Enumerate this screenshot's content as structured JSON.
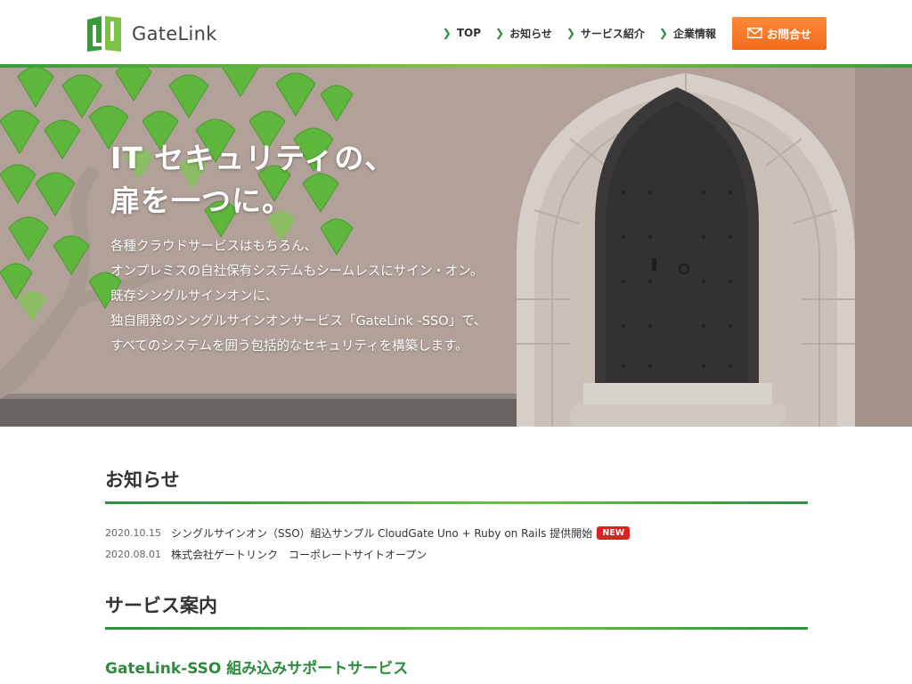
{
  "header": {
    "logo_text": "GateLink",
    "nav": [
      {
        "label": "TOP"
      },
      {
        "label": "お知らせ"
      },
      {
        "label": "サービス紹介"
      },
      {
        "label": "企業情報"
      }
    ],
    "contact_label": "お問合せ"
  },
  "hero": {
    "title_lines": [
      "IT セキュリティの、",
      "扉を一つに。"
    ],
    "body_lines": [
      "各種クラウドサービスはもちろん、",
      "オンプレミスの自社保有システムもシームレスにサイン・オン。",
      "既存シングルサインオンに、",
      "独自開発のシングルサインオンサービス「GateLink -SSO」で、",
      "すべてのシステムを囲う包括的なセキュリティを構築します。"
    ]
  },
  "news": {
    "title": "お知らせ",
    "items": [
      {
        "date": "2020.10.15",
        "text": "シングルサインオン（SSO）組込サンプル CloudGate Uno + Ruby on Rails 提供開始",
        "badge": "NEW"
      },
      {
        "date": "2020.08.01",
        "text": "株式会社ゲートリンク　コーポレートサイトオープン",
        "badge": ""
      }
    ]
  },
  "services": {
    "title": "サービス案内",
    "first_heading": "GateLink-SSO 組み込みサポートサービス"
  },
  "colors": {
    "brand_green": "#2e8b3e",
    "accent_orange": "#f26b1d",
    "badge_red": "#e02020"
  }
}
